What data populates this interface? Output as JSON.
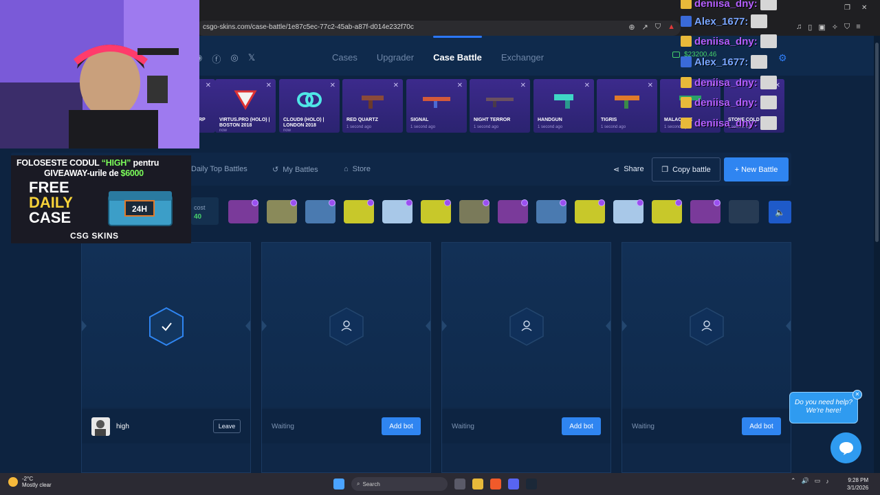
{
  "browser": {
    "url": "csgo-skins.com/case-battle/1e87c5ec-77c2-45ab-a87f-d014e232f70c"
  },
  "header": {
    "nav": [
      "Cases",
      "Upgrader",
      "Case Battle",
      "Exchanger"
    ],
    "balance": "$23200.46"
  },
  "drops": [
    {
      "name": "RP",
      "ago": ""
    },
    {
      "name": "VIRTUS.PRO (HOLO) | BOSTON 2018",
      "ago": "now"
    },
    {
      "name": "CLOUD9 (HOLO) | LONDON 2018",
      "ago": "now"
    },
    {
      "name": "RED QUARTZ",
      "ago": "1 second ago"
    },
    {
      "name": "SIGNAL",
      "ago": "1 second ago"
    },
    {
      "name": "NIGHT TERROR",
      "ago": "1 second ago"
    },
    {
      "name": "HANDGUN",
      "ago": "1 second ago"
    },
    {
      "name": "TIGRIS",
      "ago": "1 second ago"
    },
    {
      "name": "MALACHITE",
      "ago": "1 second ago"
    },
    {
      "name": "STONE COLD",
      "ago": "1 second ago"
    }
  ],
  "tabs": {
    "daily": "Daily Top Battles",
    "my": "My Battles",
    "store": "Store",
    "share": "Share",
    "copy": "Copy battle",
    "new": "+ New Battle"
  },
  "cases": {
    "cost_label": "cost",
    "cost_value": "40"
  },
  "slots": [
    {
      "status": "high",
      "button": "Leave",
      "ready": true
    },
    {
      "status": "Waiting",
      "button": "Add bot",
      "ready": false
    },
    {
      "status": "Waiting",
      "button": "Add bot",
      "ready": false
    },
    {
      "status": "Waiting",
      "button": "Add bot",
      "ready": false
    }
  ],
  "chat": {
    "line1": "Do you need help?",
    "line2": "We're here!"
  },
  "promo": {
    "line1a": "FOLOSESTE CODUL ",
    "line1b": "“HIGH”",
    "line1c": " pentru",
    "line2a": "GIVEAWAY-urile de ",
    "line2b": "$6000",
    "big1": "FREE",
    "big2": "DAILY",
    "big3": "CASE",
    "logo": "CSG SKINS",
    "box": "24H"
  },
  "overlay_chat": [
    {
      "name": "deniisa_dny:",
      "blue": false
    },
    {
      "name": "Alex_1677:",
      "blue": true
    },
    {
      "name": "deniisa_dny:",
      "blue": false
    },
    {
      "name": "Alex_1677:",
      "blue": true
    },
    {
      "name": "deniisa_dny:",
      "blue": false
    },
    {
      "name": "deniisa_dny:",
      "blue": false
    },
    {
      "name": "deniisa_dny:",
      "blue": false
    }
  ],
  "taskbar": {
    "temp": "-2°C",
    "weather": "Mostly clear",
    "search": "Search",
    "time": "9:28 PM",
    "date": "3/1/2026"
  },
  "colors": {
    "accent": "#2f85f1",
    "money": "#47d36b",
    "drop_card": "#3c2a8c"
  }
}
